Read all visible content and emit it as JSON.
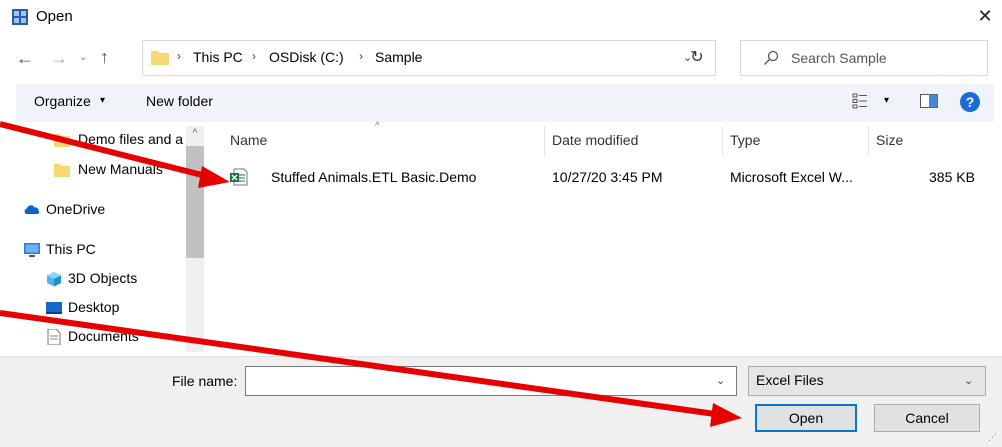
{
  "window": {
    "title": "Open",
    "close_glyph": "✕"
  },
  "nav_buttons": {
    "back": "←",
    "forward": "→",
    "recent": "⌄",
    "up": "↑"
  },
  "address": {
    "crumbs": [
      "This PC",
      "OSDisk (C:)",
      "Sample"
    ],
    "separator": "›",
    "dropdown_glyph": "⌄"
  },
  "refresh_glyph": "↻",
  "search": {
    "placeholder": "Search Sample"
  },
  "toolbar": {
    "organize": "Organize",
    "caret": "▾",
    "new_folder": "New folder",
    "help": "?"
  },
  "nav_pane": {
    "items": [
      {
        "label": "Demo files and a",
        "icon": "folder-icon"
      },
      {
        "label": "New Manuals",
        "icon": "folder-icon"
      },
      {
        "label": "OneDrive",
        "icon": "onedrive-icon"
      },
      {
        "label": "This PC",
        "icon": "computer-icon"
      },
      {
        "label": "3D Objects",
        "icon": "3d-objects-icon"
      },
      {
        "label": "Desktop",
        "icon": "desktop-icon"
      },
      {
        "label": "Documents",
        "icon": "documents-icon"
      }
    ],
    "scroll_up": "^",
    "scroll_down": "⌄"
  },
  "file_list": {
    "columns": {
      "name": "Name",
      "date": "Date modified",
      "type": "Type",
      "size": "Size"
    },
    "sort_caret": "^",
    "rows": [
      {
        "name": "Stuffed Animals.ETL Basic.Demo",
        "date": "10/27/20   3:45 PM",
        "type": "Microsoft Excel W...",
        "size": "385 KB",
        "icon": "excel-file-icon"
      }
    ]
  },
  "footer": {
    "file_name_label": "File name:",
    "file_name_value": "",
    "dropdown_glyph": "⌄",
    "filter": "Excel Files",
    "open_label": "Open",
    "cancel_label": "Cancel"
  },
  "colors": {
    "accent": "#0078d7",
    "annotation_arrow": "#e60000",
    "folder": "#f8d775",
    "excel": "#1e7145"
  }
}
